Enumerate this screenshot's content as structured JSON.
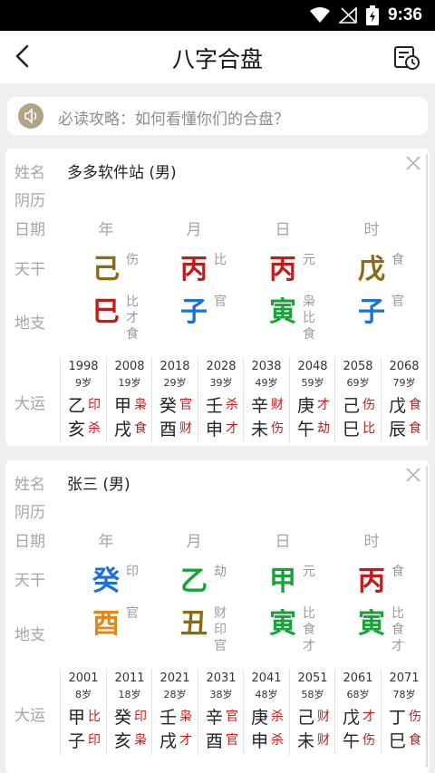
{
  "status": {
    "time": "9:36"
  },
  "header": {
    "title": "八字合盘"
  },
  "tip": {
    "text": "必读攻略：如何看懂你们的合盘？"
  },
  "labels": {
    "name": "姓名",
    "lunar": "阴历",
    "date": "日期",
    "heaven": "天干",
    "earth": "地支",
    "luck": "大运"
  },
  "pillar_heads": [
    "年",
    "月",
    "日",
    "时"
  ],
  "colors": {
    "earth_brown": "#8a6a12",
    "fire_red": "#c41a1a",
    "water_blue": "#1e6fd9",
    "wood_green": "#17a33a",
    "metal_orange": "#e0891a",
    "gray_bg": "#efefef"
  },
  "cards": [
    {
      "name": "多多软件站 (男)",
      "pillars": [
        {
          "heaven": {
            "char": "己",
            "color": "#8a6a12",
            "god": "伤"
          },
          "earth": {
            "char": "巳",
            "color": "#c41a1a",
            "gods": [
              "比",
              "才",
              "食"
            ]
          }
        },
        {
          "heaven": {
            "char": "丙",
            "color": "#c41a1a",
            "god": "比"
          },
          "earth": {
            "char": "子",
            "color": "#1e6fd9",
            "gods": [
              "官"
            ]
          }
        },
        {
          "heaven": {
            "char": "丙",
            "color": "#c41a1a",
            "god": "元"
          },
          "earth": {
            "char": "寅",
            "color": "#17a33a",
            "gods": [
              "枭",
              "比",
              "食"
            ]
          }
        },
        {
          "heaven": {
            "char": "戊",
            "color": "#8a6a12",
            "god": "食"
          },
          "earth": {
            "char": "子",
            "color": "#1e6fd9",
            "gods": [
              "官"
            ]
          }
        }
      ],
      "luck": [
        {
          "year": "1998",
          "age": "9岁",
          "top": "乙",
          "top_t": "印",
          "bot": "亥",
          "bot_t": "杀"
        },
        {
          "year": "2008",
          "age": "19岁",
          "top": "甲",
          "top_t": "枭",
          "bot": "戌",
          "bot_t": "食"
        },
        {
          "year": "2018",
          "age": "29岁",
          "top": "癸",
          "top_t": "官",
          "bot": "酉",
          "bot_t": "财"
        },
        {
          "year": "2028",
          "age": "39岁",
          "top": "壬",
          "top_t": "杀",
          "bot": "申",
          "bot_t": "才"
        },
        {
          "year": "2038",
          "age": "49岁",
          "top": "辛",
          "top_t": "财",
          "bot": "未",
          "bot_t": "伤"
        },
        {
          "year": "2048",
          "age": "59岁",
          "top": "庚",
          "top_t": "才",
          "bot": "午",
          "bot_t": "劫"
        },
        {
          "year": "2058",
          "age": "69岁",
          "top": "己",
          "top_t": "伤",
          "bot": "巳",
          "bot_t": "比"
        },
        {
          "year": "2068",
          "age": "79岁",
          "top": "戊",
          "top_t": "食",
          "bot": "辰",
          "bot_t": "食"
        }
      ]
    },
    {
      "name": "张三 (男)",
      "pillars": [
        {
          "heaven": {
            "char": "癸",
            "color": "#1e6fd9",
            "god": "印"
          },
          "earth": {
            "char": "酉",
            "color": "#e0891a",
            "gods": [
              "官"
            ]
          }
        },
        {
          "heaven": {
            "char": "乙",
            "color": "#17a33a",
            "god": "劫"
          },
          "earth": {
            "char": "丑",
            "color": "#8a6a12",
            "gods": [
              "财",
              "印",
              "官"
            ]
          }
        },
        {
          "heaven": {
            "char": "甲",
            "color": "#17a33a",
            "god": "元"
          },
          "earth": {
            "char": "寅",
            "color": "#17a33a",
            "gods": [
              "比",
              "食",
              "才"
            ]
          }
        },
        {
          "heaven": {
            "char": "丙",
            "color": "#c41a1a",
            "god": "食"
          },
          "earth": {
            "char": "寅",
            "color": "#17a33a",
            "gods": [
              "比",
              "食",
              "才"
            ]
          }
        }
      ],
      "luck": [
        {
          "year": "2001",
          "age": "8岁",
          "top": "甲",
          "top_t": "比",
          "bot": "子",
          "bot_t": "印"
        },
        {
          "year": "2011",
          "age": "18岁",
          "top": "癸",
          "top_t": "印",
          "bot": "亥",
          "bot_t": "枭"
        },
        {
          "year": "2021",
          "age": "28岁",
          "top": "壬",
          "top_t": "枭",
          "bot": "戌",
          "bot_t": "才"
        },
        {
          "year": "2031",
          "age": "38岁",
          "top": "辛",
          "top_t": "官",
          "bot": "酉",
          "bot_t": "官"
        },
        {
          "year": "2041",
          "age": "48岁",
          "top": "庚",
          "top_t": "杀",
          "bot": "申",
          "bot_t": "杀"
        },
        {
          "year": "2051",
          "age": "58岁",
          "top": "己",
          "top_t": "财",
          "bot": "未",
          "bot_t": "财"
        },
        {
          "year": "2061",
          "age": "68岁",
          "top": "戊",
          "top_t": "才",
          "bot": "午",
          "bot_t": "伤"
        },
        {
          "year": "2071",
          "age": "78岁",
          "top": "丁",
          "top_t": "伤",
          "bot": "巳",
          "bot_t": "食"
        }
      ]
    }
  ]
}
